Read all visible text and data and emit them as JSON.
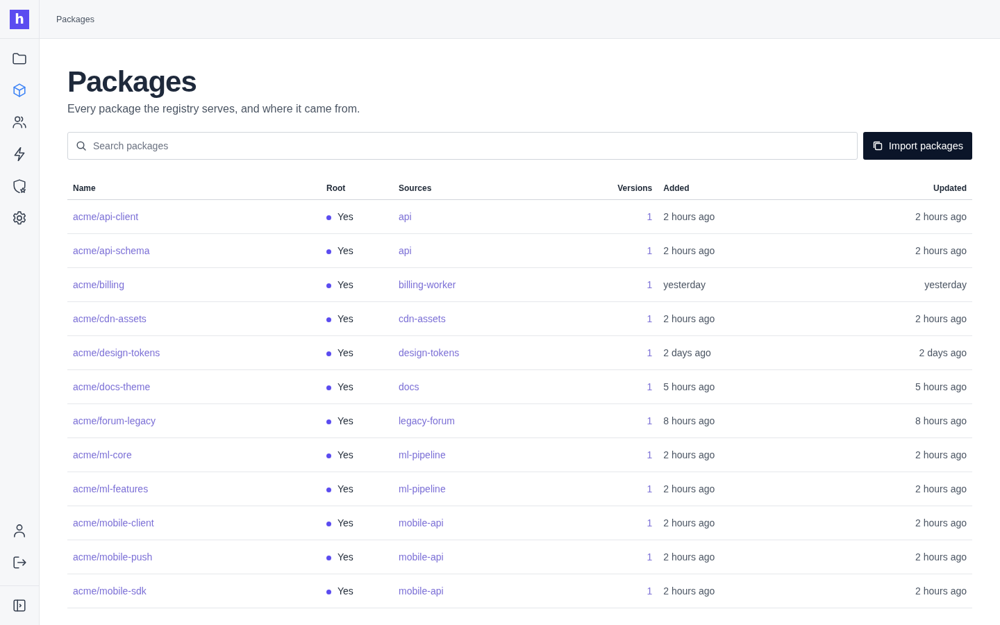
{
  "logo": {
    "letter": "h"
  },
  "sidebar": {
    "items": [
      {
        "kind": "folder",
        "selected": false
      },
      {
        "kind": "package",
        "selected": true
      },
      {
        "kind": "users",
        "selected": false
      },
      {
        "kind": "bolt",
        "selected": false
      },
      {
        "kind": "shield",
        "selected": false
      },
      {
        "kind": "settings",
        "selected": false
      }
    ],
    "bottom_items": [
      {
        "kind": "user"
      },
      {
        "kind": "logout"
      }
    ],
    "toggle": {
      "kind": "panel"
    }
  },
  "breadcrumb": "Packages",
  "page": {
    "title": "Packages",
    "subtitle": "Every package the registry serves, and where it came from."
  },
  "search": {
    "placeholder": "Search packages"
  },
  "import_button": "Import packages",
  "table": {
    "columns": [
      "Name",
      "Root",
      "Sources",
      "Versions",
      "Added",
      "Updated"
    ],
    "rows": [
      {
        "name": "acme/api-client",
        "root": "Yes",
        "is_root": true,
        "source": "api",
        "versions": "1",
        "added": "2 hours ago",
        "updated": "2 hours ago"
      },
      {
        "name": "acme/api-schema",
        "root": "Yes",
        "is_root": true,
        "source": "api",
        "versions": "1",
        "added": "2 hours ago",
        "updated": "2 hours ago"
      },
      {
        "name": "acme/billing",
        "root": "Yes",
        "is_root": true,
        "source": "billing-worker",
        "versions": "1",
        "added": "yesterday",
        "updated": "yesterday"
      },
      {
        "name": "acme/cdn-assets",
        "root": "Yes",
        "is_root": true,
        "source": "cdn-assets",
        "versions": "1",
        "added": "2 hours ago",
        "updated": "2 hours ago"
      },
      {
        "name": "acme/design-tokens",
        "root": "Yes",
        "is_root": true,
        "source": "design-tokens",
        "versions": "1",
        "added": "2 days ago",
        "updated": "2 days ago"
      },
      {
        "name": "acme/docs-theme",
        "root": "Yes",
        "is_root": true,
        "source": "docs",
        "versions": "1",
        "added": "5 hours ago",
        "updated": "5 hours ago"
      },
      {
        "name": "acme/forum-legacy",
        "root": "Yes",
        "is_root": true,
        "source": "legacy-forum",
        "versions": "1",
        "added": "8 hours ago",
        "updated": "8 hours ago"
      },
      {
        "name": "acme/ml-core",
        "root": "Yes",
        "is_root": true,
        "source": "ml-pipeline",
        "versions": "1",
        "added": "2 hours ago",
        "updated": "2 hours ago"
      },
      {
        "name": "acme/ml-features",
        "root": "Yes",
        "is_root": true,
        "source": "ml-pipeline",
        "versions": "1",
        "added": "2 hours ago",
        "updated": "2 hours ago"
      },
      {
        "name": "acme/mobile-client",
        "root": "Yes",
        "is_root": true,
        "source": "mobile-api",
        "versions": "1",
        "added": "2 hours ago",
        "updated": "2 hours ago"
      },
      {
        "name": "acme/mobile-push",
        "root": "Yes",
        "is_root": true,
        "source": "mobile-api",
        "versions": "1",
        "added": "2 hours ago",
        "updated": "2 hours ago"
      },
      {
        "name": "acme/mobile-sdk",
        "root": "Yes",
        "is_root": true,
        "source": "mobile-api",
        "versions": "1",
        "added": "2 hours ago",
        "updated": "2 hours ago"
      }
    ]
  }
}
